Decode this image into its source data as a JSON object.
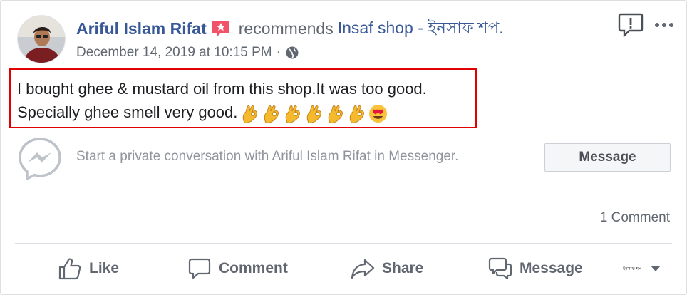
{
  "post": {
    "author_name": "Ariful Islam Rifat",
    "recommends_text": "recommends",
    "page_name": "Insaf shop - ইনসাফ শপ.",
    "date": "December 14, 2019 at 10:15 PM",
    "separator": "·",
    "privacy_icon": "globe-icon",
    "text_line_1": "I bought ghee & mustard oil from this shop.It was too good.",
    "text_line_2": "Specially ghee smell very good.",
    "emojis": [
      "ok-hand-emoji",
      "ok-hand-emoji",
      "ok-hand-emoji",
      "ok-hand-emoji",
      "ok-hand-emoji",
      "ok-hand-emoji",
      "heart-eyes-emoji"
    ]
  },
  "messenger": {
    "prompt": "Start a private conversation with Ariful Islam Rifat in Messenger.",
    "button_label": "Message"
  },
  "stats": {
    "comment_count": "1 Comment"
  },
  "actions": {
    "like": "Like",
    "comment": "Comment",
    "share": "Share",
    "message": "Message"
  },
  "page_selector": {
    "thumb_text": "ইনসাফ শপ"
  },
  "colors": {
    "link_blue": "#385898",
    "secondary_gray": "#606770",
    "muted_gray": "#90949c",
    "highlight_red": "#e00000",
    "badge_pink": "#f25268"
  }
}
